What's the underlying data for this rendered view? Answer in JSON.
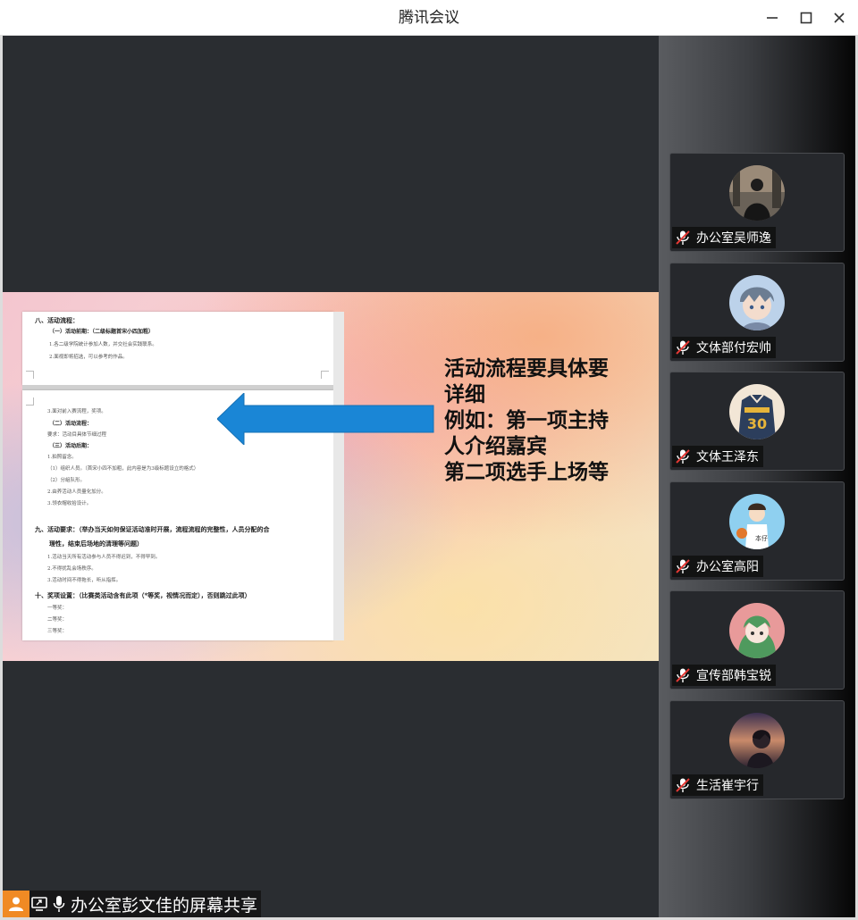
{
  "window": {
    "title": "腾讯会议",
    "controls": [
      "minimize-icon",
      "maximize-icon",
      "close-icon"
    ]
  },
  "share": {
    "label": "办公室彭文佳的屏幕共享",
    "icons": [
      "person-icon",
      "screen-share-icon",
      "mic-icon"
    ],
    "document": {
      "page1_lines": [
        "八、活动流程：",
        "（一）活动前期：（二级标题首宋小四加粗）",
        "1.各二级学院统计参加人数，并交社会实践联系。",
        "2.面视即将招选，可以参考的作品。"
      ],
      "page2_lines": [
        "3.面对前入赛流程，奖项。",
        "（二）活动流程：",
        "要求：活动目具体节细过程",
        "（三）活动后期：",
        "1.拍照留念。",
        "（1）组织人员。（首宋小四不加粗，此内容是为3级标题设立的格式）",
        "（2）分組队形。",
        "2.由养活动人员量化加分。",
        "3.领衣帽收拾设计。",
        "九、活动要求：（举办当天如何保证活动准时开展，流程流程的完整性，人员分配的合",
        "理性，结束后场地的清理等问题）",
        "1.活动当天所有活动参与人员不得迟到，不得早到。",
        "2.不得扰乱会场秩序。",
        "3.活动时间不得拖长，听从指挥。",
        "十、奖项设置：（比赛类活动含有此项（*等奖，视情况而定），否则跳过此项）",
        "一等奖：",
        "二等奖：",
        "三等奖："
      ]
    },
    "annotation_lines": [
      "活动流程要具体要",
      "详细",
      "例如：第一项主持",
      "人介绍嘉宾",
      "第二项选手上场等"
    ],
    "arrow_color": "#1a86d6",
    "accent_color": "#f08a24"
  },
  "participants": [
    {
      "name": "办公室吴师逸",
      "mic": "mic-muted-icon",
      "avatar": "photo-avatar-person-in-city"
    },
    {
      "name": "文体部付宏帅",
      "mic": "mic-muted-icon",
      "avatar": "anime-avatar-boy"
    },
    {
      "name": "文体王泽东",
      "mic": "mic-muted-icon",
      "avatar": "jersey-30-avatar"
    },
    {
      "name": "办公室高阳",
      "mic": "mic-muted-icon",
      "avatar": "cartoon-basketball-boy-avatar"
    },
    {
      "name": "宣传部韩宝锐",
      "mic": "mic-muted-icon",
      "avatar": "anime-green-hair-avatar"
    },
    {
      "name": "生活崔宇行",
      "mic": "mic-muted-icon",
      "avatar": "anime-sunset-avatar"
    }
  ]
}
